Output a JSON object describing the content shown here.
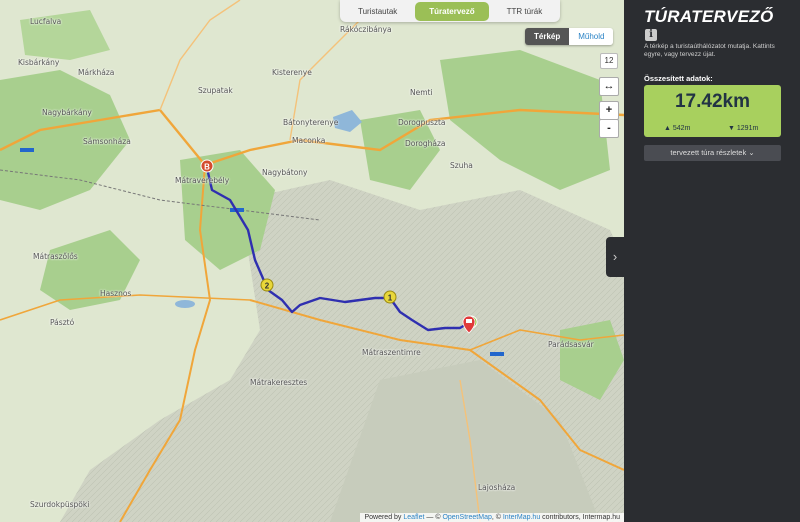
{
  "tabs": [
    {
      "label": "Turistautak",
      "active": false
    },
    {
      "label": "Túratervező",
      "active": true
    },
    {
      "label": "TTR túrák",
      "active": false
    }
  ],
  "layers": {
    "map": "Térkép",
    "satellite": "Műhold",
    "active": "Térkép"
  },
  "zoom": "12",
  "zoom_in": "+",
  "zoom_out": "-",
  "fullscreen_icon": "↔",
  "attribution": {
    "prefix": "Powered by",
    "leaflet": "Leaflet",
    "sep": "—",
    "osm": "OpenStreetMap",
    "intermap": "InterMap.hu",
    "suffix": "contributors, Intermap.hu"
  },
  "places": [
    {
      "name": "Lucfalva"
    },
    {
      "name": "Rákóczibánya"
    },
    {
      "name": "Kisbárkány"
    },
    {
      "name": "Márkháza"
    },
    {
      "name": "Kisterenye"
    },
    {
      "name": "Szupatak"
    },
    {
      "name": "Nemti"
    },
    {
      "name": "Nagybárkány"
    },
    {
      "name": "Sámsonháza"
    },
    {
      "name": "Bátonyterenye"
    },
    {
      "name": "Dorogpuszta"
    },
    {
      "name": "Maconka"
    },
    {
      "name": "Dorogháza"
    },
    {
      "name": "Szuha"
    },
    {
      "name": "Mátraverebély"
    },
    {
      "name": "Nagybátony"
    },
    {
      "name": "Mátraszőlős"
    },
    {
      "name": "Hasznos"
    },
    {
      "name": "Pásztó"
    },
    {
      "name": "Mátraszentimre"
    },
    {
      "name": "Parádsasvár"
    },
    {
      "name": "Mátrakeresztes"
    },
    {
      "name": "Szurdokpüspöki"
    },
    {
      "name": "Lajosháza"
    }
  ],
  "route": {
    "start_marker": "A",
    "end_marker": "B",
    "waypoints": [
      "1",
      "2"
    ],
    "color": "#2f2fb0"
  },
  "collapse_icon": "›",
  "panel": {
    "title": "TÚRATERVEZŐ",
    "info_icon": "i",
    "description": "A térkép a turistaúthálózatot mutatja. Kattints egyre, vagy tervezz újat.",
    "summary_label": "Összesített adatok:",
    "distance": "17.42km",
    "ascent": "542m",
    "descent": "1291m",
    "details_button": "tervezett túra részletek"
  },
  "colors": {
    "accent": "#9bbf56",
    "panel_bg": "#2b2d31",
    "stats_bg": "#a8d05e",
    "road": "#f0a63a"
  }
}
